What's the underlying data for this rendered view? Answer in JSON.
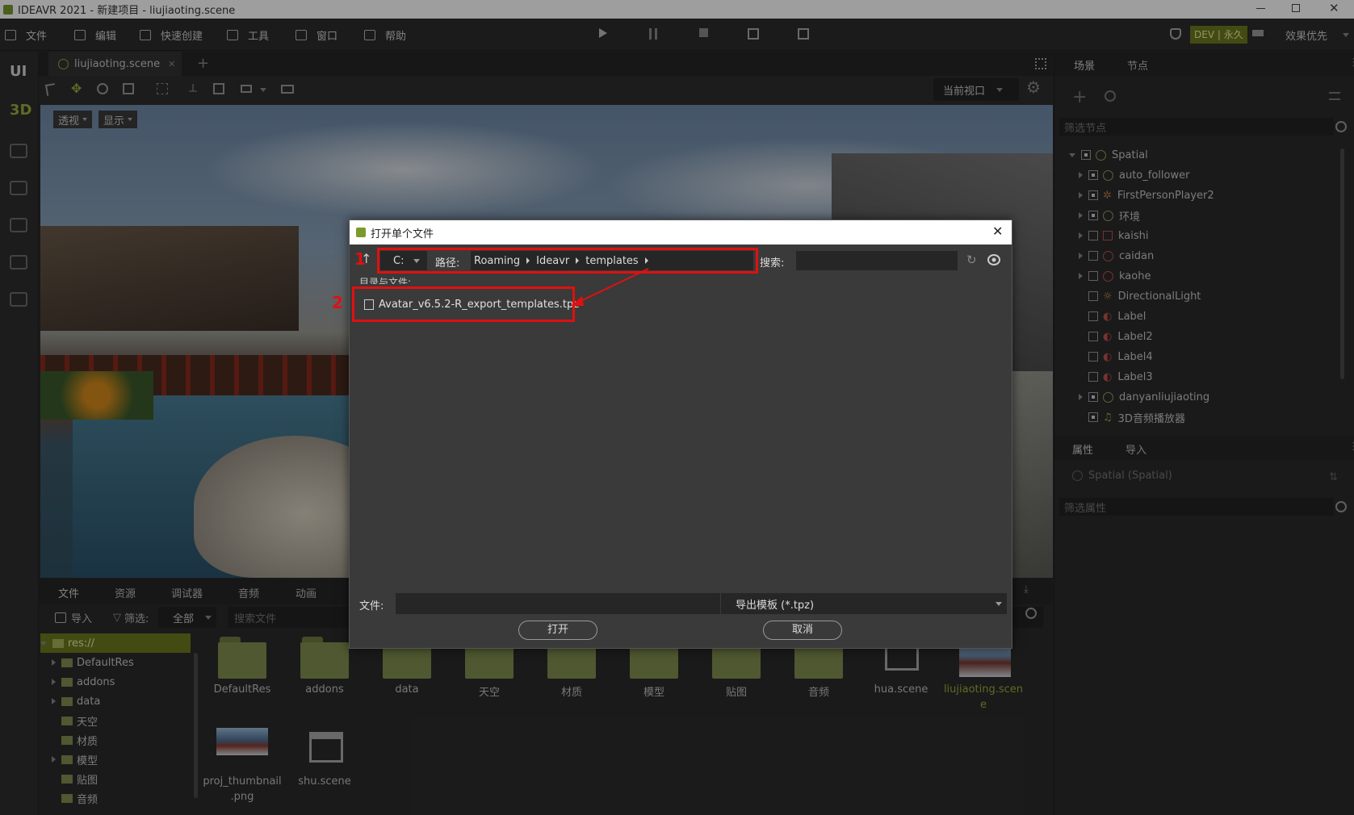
{
  "window": {
    "title": "IDEAVR 2021 - 新建项目 - liujiaoting.scene"
  },
  "menu": {
    "items": [
      "文件",
      "编辑",
      "快速创建",
      "工具",
      "窗口",
      "帮助"
    ],
    "badge": "DEV | 永久",
    "quality": "效果优先"
  },
  "sidebar": {
    "ui_label": "UI",
    "threed_label": "3D"
  },
  "editor": {
    "tab_name": "liujiaoting.scene",
    "view_dropdown": "当前视口",
    "perspective_btn": "透视",
    "display_btn": "显示"
  },
  "bottom": {
    "tabs": [
      "文件",
      "资源",
      "调试器",
      "音频",
      "动画"
    ],
    "import_label": "导入",
    "filter_label": "筛选:",
    "filter_value": "全部",
    "search_placeholder": "搜索文件",
    "tree": [
      "res://",
      "DefaultRes",
      "addons",
      "data",
      "天空",
      "材质",
      "模型",
      "贴图",
      "音频"
    ],
    "files": [
      "DefaultRes",
      "addons",
      "data",
      "天空",
      "材质",
      "模型",
      "贴图",
      "音频",
      "hua.scene",
      "liujiaoting.scen",
      "e",
      "proj_thumbnail",
      ".png",
      "shu.scene"
    ]
  },
  "right": {
    "tabs": [
      "场景",
      "节点"
    ],
    "filter_nodes_placeholder": "筛选节点",
    "nodes": [
      "Spatial",
      "auto_follower",
      "FirstPersonPlayer2",
      "环境",
      "kaishi",
      "caidan",
      "kaohe",
      "DirectionalLight",
      "Label",
      "Label2",
      "Label4",
      "Label3",
      "danyanliujiaoting",
      "3D音频播放器"
    ],
    "prop_tabs": [
      "属性",
      "导入"
    ],
    "prop_root": "Spatial (Spatial)",
    "filter_props_placeholder": "筛选属性"
  },
  "dialog": {
    "title": "打开单个文件",
    "drive": "C:",
    "path_label": "路径:",
    "path": [
      "Roaming",
      "Ideavr",
      "templates"
    ],
    "search_label": "搜索:",
    "dir_label": "目录与文件:",
    "file_item": "Avatar_v6.5.2-R_export_templates.tpz",
    "file_label": "文件:",
    "filter": "导出模板 (*.tpz)",
    "open_btn": "打开",
    "cancel_btn": "取消",
    "marker1": "1",
    "marker2": "2"
  },
  "colors": {
    "accent": "#9cab3c",
    "highlight": "#e01010",
    "badge_bg": "#6c7a1e"
  }
}
